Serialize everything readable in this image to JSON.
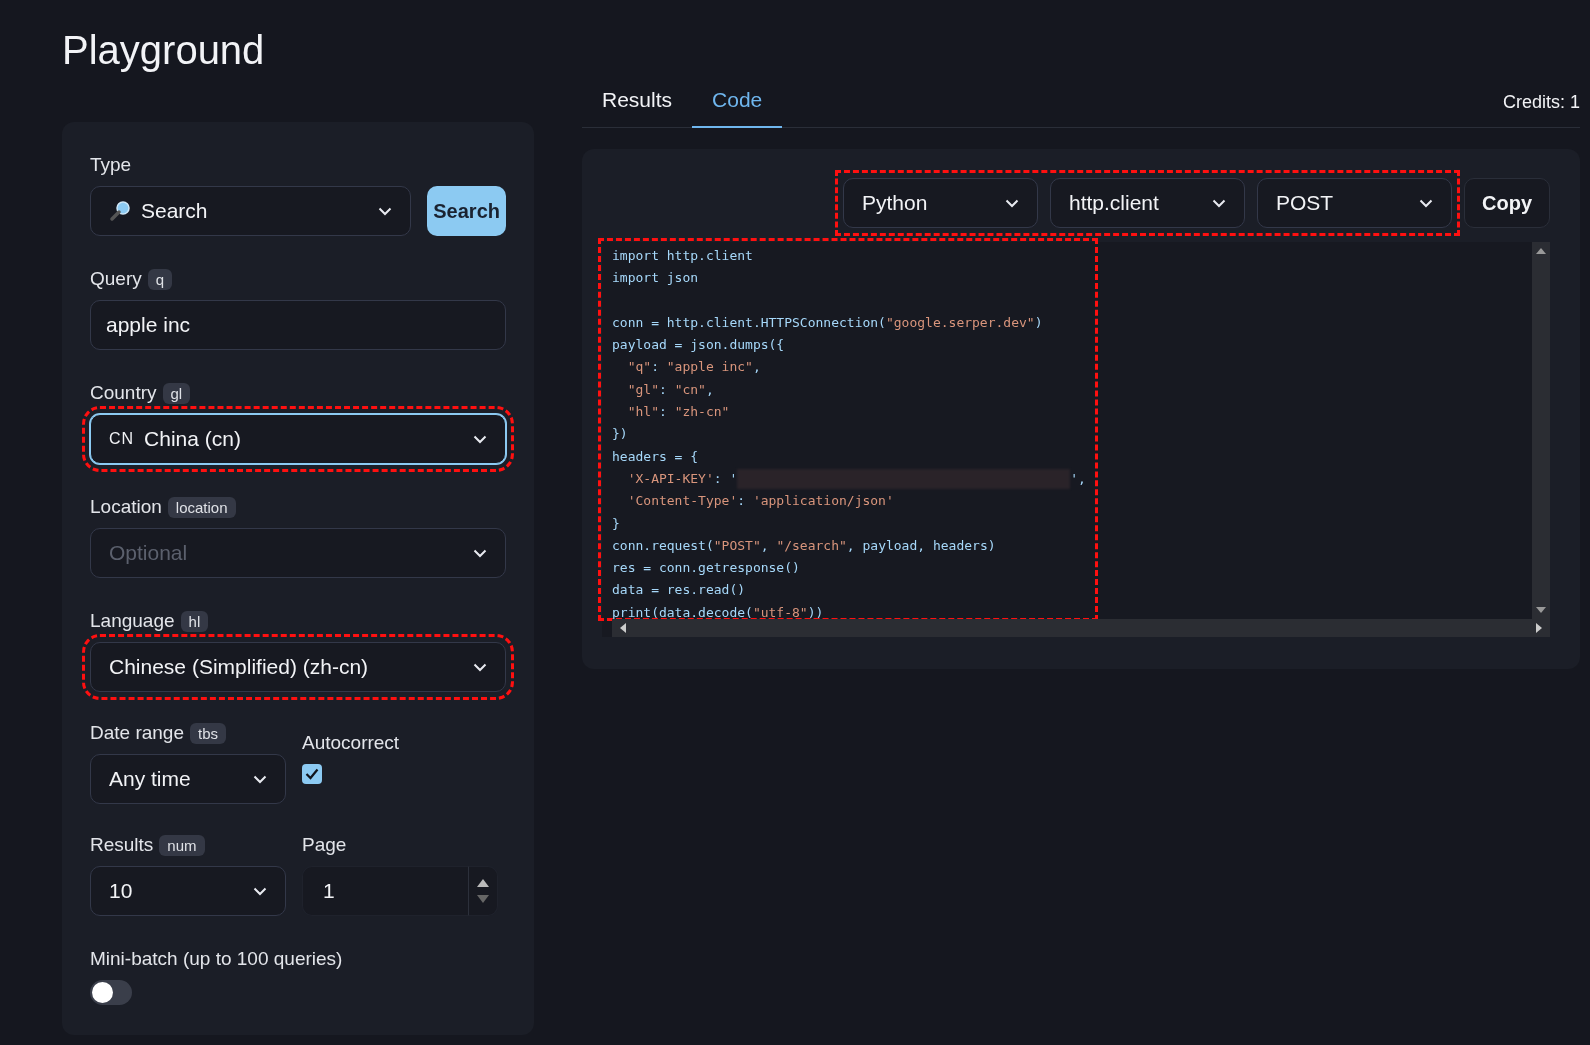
{
  "page_title": "Playground",
  "form": {
    "type": {
      "label": "Type",
      "value": "Search"
    },
    "search_button": "Search",
    "query": {
      "label": "Query",
      "tag": "q",
      "value": "apple inc"
    },
    "country": {
      "label": "Country",
      "tag": "gl",
      "flag": "CN",
      "value": "China (cn)",
      "focused": true,
      "highlighted": true
    },
    "location": {
      "label": "Location",
      "tag": "location",
      "placeholder": "Optional"
    },
    "language": {
      "label": "Language",
      "tag": "hl",
      "value": "Chinese (Simplified) (zh-cn)",
      "highlighted": true
    },
    "date_range": {
      "label": "Date range",
      "tag": "tbs",
      "value": "Any time"
    },
    "autocorrect": {
      "label": "Autocorrect",
      "checked": true
    },
    "results": {
      "label": "Results",
      "tag": "num",
      "value": "10"
    },
    "page": {
      "label": "Page",
      "value": "1"
    },
    "mini_batch": {
      "label": "Mini-batch (up to 100 queries)",
      "on": false
    }
  },
  "tabs": [
    {
      "label": "Results",
      "selected": false
    },
    {
      "label": "Code",
      "selected": true
    }
  ],
  "credits": "Credits: 1",
  "code_panel": {
    "selects_highlighted": true,
    "selects": [
      "Python",
      "http.client",
      "POST"
    ],
    "copy_button": "Copy",
    "code_highlighted": true,
    "lines": [
      {
        "kind": "code",
        "text": "import http.client"
      },
      {
        "kind": "code",
        "text": "import json"
      },
      {
        "kind": "blank"
      },
      {
        "kind": "code",
        "text": "conn = http.client.HTTPSConnection(\"google.serper.dev\")"
      },
      {
        "kind": "code",
        "text": "payload = json.dumps({"
      },
      {
        "kind": "code",
        "text": "  \"q\": \"apple inc\","
      },
      {
        "kind": "code",
        "text": "  \"gl\": \"cn\","
      },
      {
        "kind": "code",
        "text": "  \"hl\": \"zh-cn\""
      },
      {
        "kind": "code",
        "text": "})"
      },
      {
        "kind": "code",
        "text": "headers = {"
      },
      {
        "kind": "redacted",
        "text": "  'X-API-KEY': '",
        "after": "',"
      },
      {
        "kind": "code",
        "text": "  'Content-Type': 'application/json'"
      },
      {
        "kind": "code",
        "text": "}"
      },
      {
        "kind": "code",
        "text": "conn.request(\"POST\", \"/search\", payload, headers)"
      },
      {
        "kind": "code",
        "text": "res = conn.getresponse()"
      },
      {
        "kind": "code",
        "text": "data = res.read()"
      },
      {
        "kind": "code",
        "text": "print(data.decode(\"utf-8\"))"
      }
    ]
  }
}
